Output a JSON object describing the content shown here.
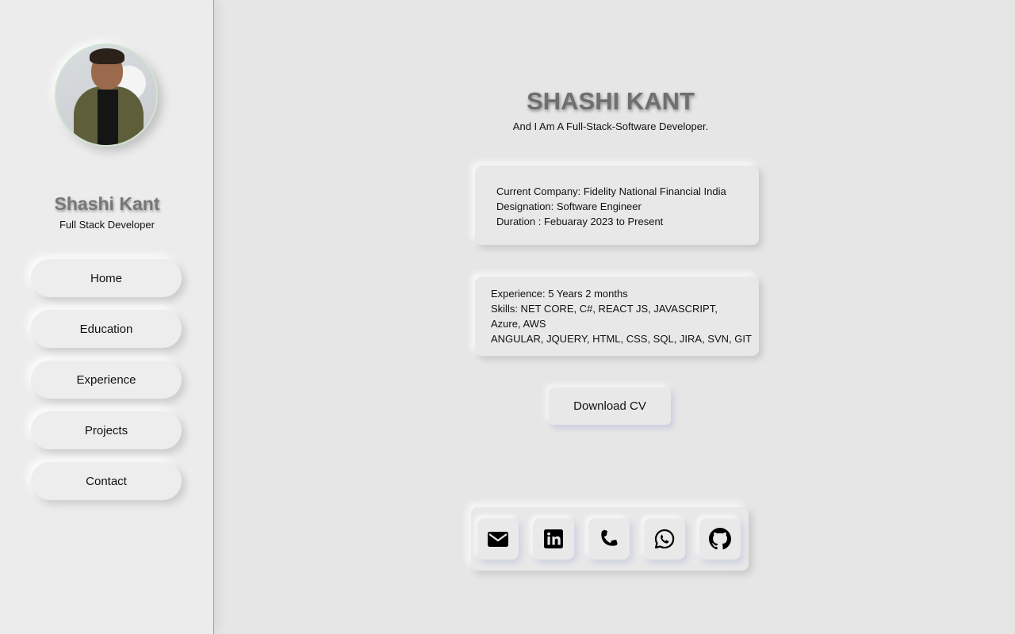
{
  "sidebar": {
    "name": "Shashi Kant",
    "role": "Full Stack Developer",
    "nav": [
      {
        "label": "Home"
      },
      {
        "label": "Education"
      },
      {
        "label": "Experience"
      },
      {
        "label": "Projects"
      },
      {
        "label": "Contact"
      }
    ]
  },
  "main": {
    "title": "SHASHI KANT",
    "subtitle": "And I Am A Full-Stack-Software Developer.",
    "job_card": {
      "lines": [
        "Current Company: Fidelity National Financial India",
        "Designation: Software Engineer",
        "Duration : Febuaray 2023 to Present"
      ]
    },
    "skills_card": {
      "lines": [
        "Experience: 5 Years 2 months",
        "Skills: NET CORE, C#, REACT JS, JAVASCRIPT,",
        "Azure, AWS",
        "ANGULAR, JQUERY, HTML, CSS, SQL, JIRA, SVN, GIT"
      ]
    },
    "download_label": "Download CV"
  },
  "social": [
    {
      "icon": "envelope-icon"
    },
    {
      "icon": "linkedin-icon"
    },
    {
      "icon": "phone-icon"
    },
    {
      "icon": "whatsapp-icon"
    },
    {
      "icon": "github-icon"
    }
  ],
  "colors": {
    "background": "#e6e6e6",
    "sidebar": "#ececec",
    "title_text": "#6f6f6f"
  }
}
